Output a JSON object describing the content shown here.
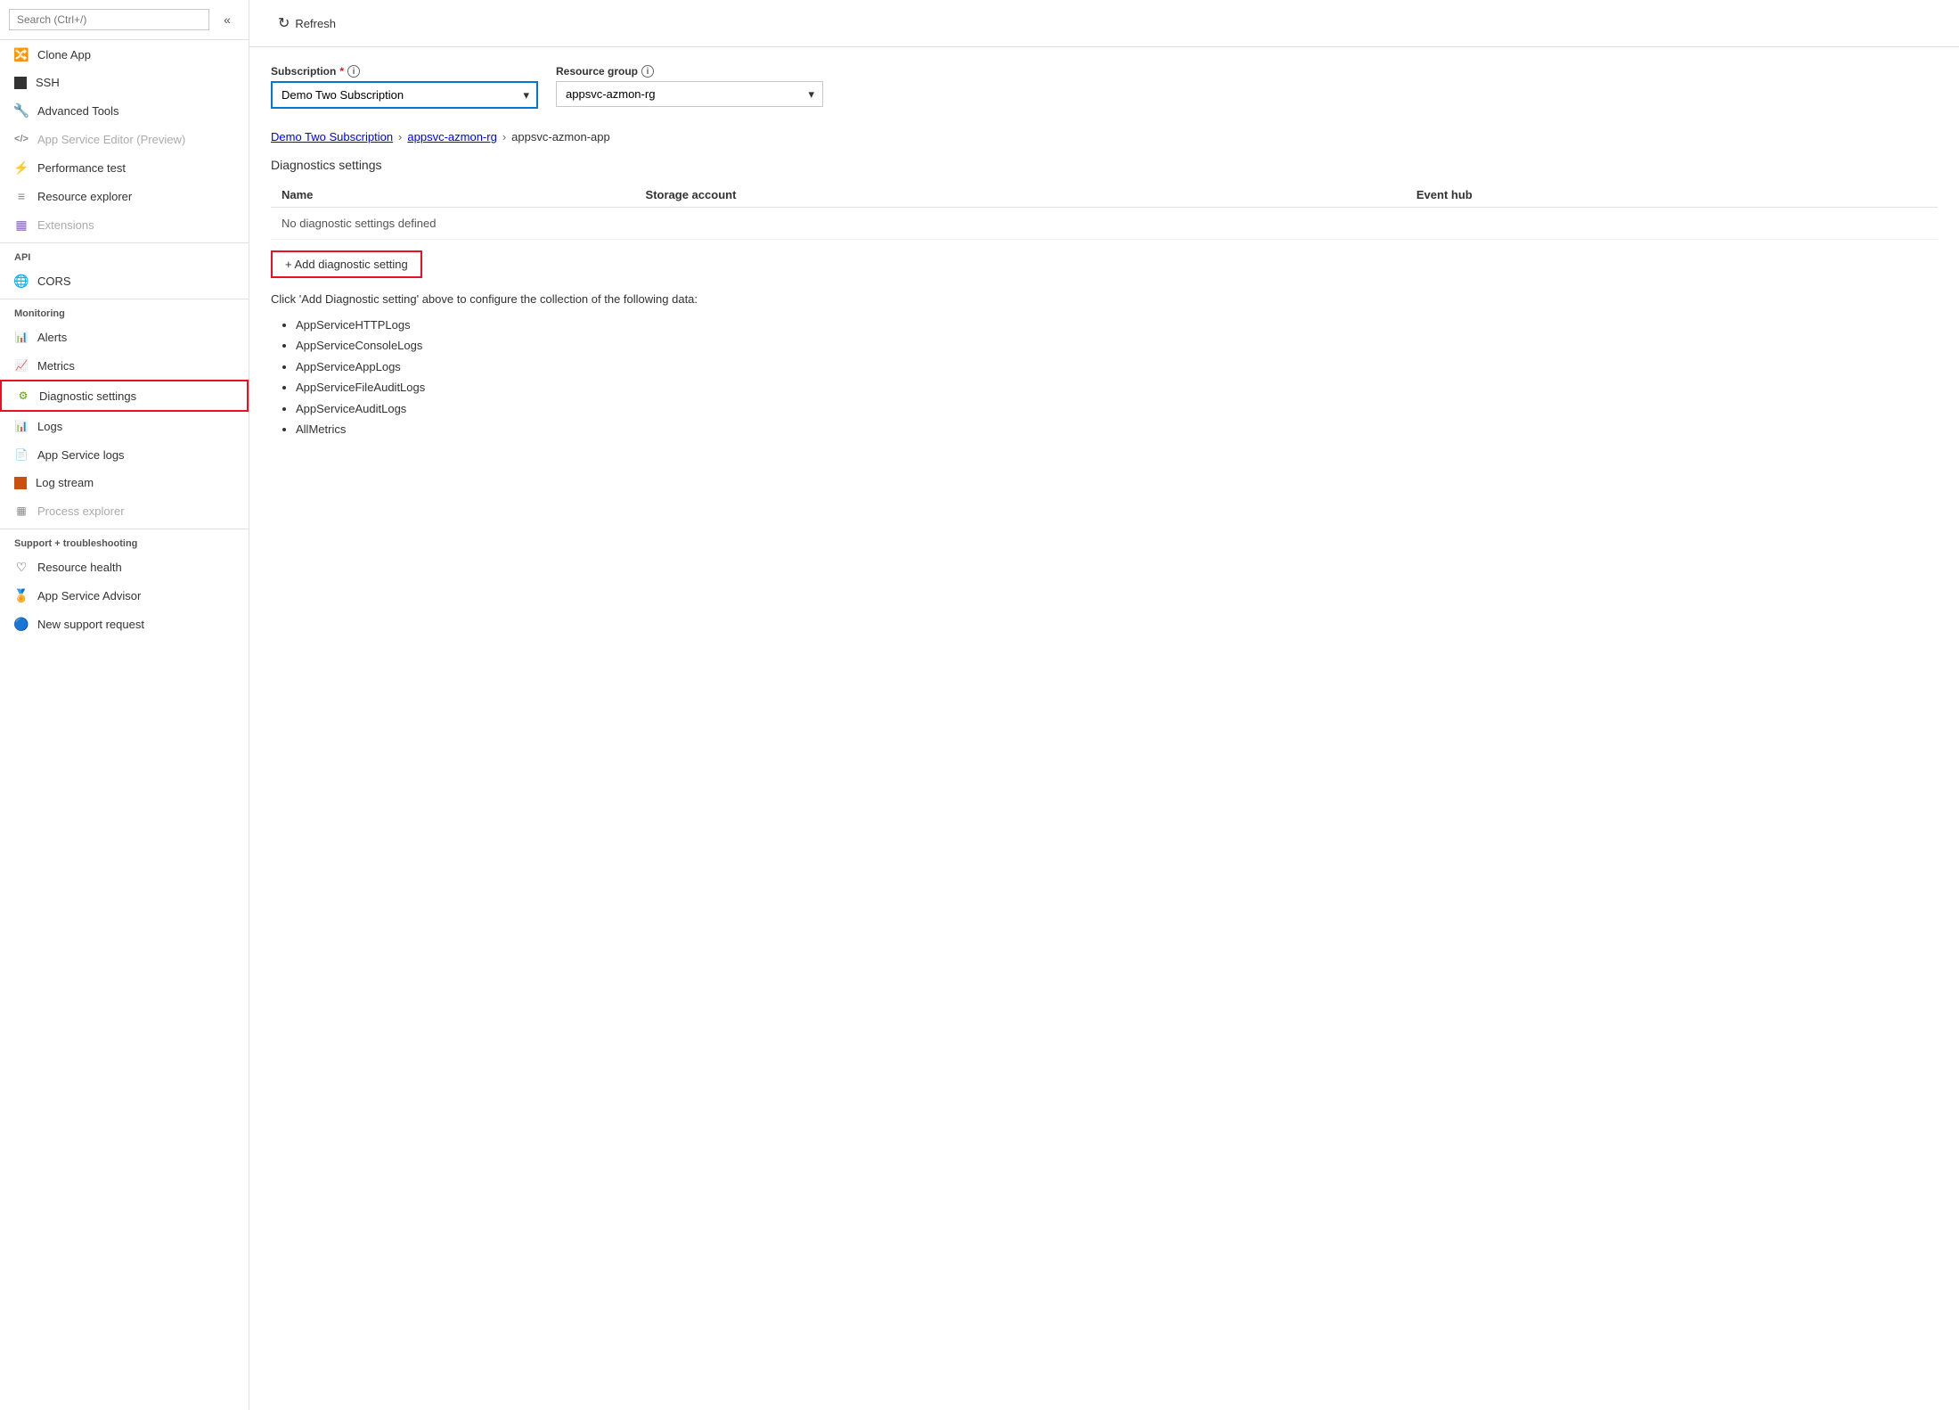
{
  "sidebar": {
    "search_placeholder": "Search (Ctrl+/)",
    "items": [
      {
        "id": "clone-app",
        "label": "Clone App",
        "icon": "🔀",
        "icon_color": "icon-green",
        "disabled": false
      },
      {
        "id": "ssh",
        "label": "SSH",
        "icon": "⬛",
        "icon_color": "icon-gray",
        "disabled": false
      },
      {
        "id": "advanced-tools",
        "label": "Advanced Tools",
        "icon": "🔧",
        "icon_color": "icon-blue",
        "disabled": false
      },
      {
        "id": "app-service-editor",
        "label": "App Service Editor (Preview)",
        "icon": "</>",
        "icon_color": "icon-gray",
        "disabled": true
      },
      {
        "id": "performance-test",
        "label": "Performance test",
        "icon": "⚡",
        "icon_color": "icon-blue",
        "disabled": false
      },
      {
        "id": "resource-explorer",
        "label": "Resource explorer",
        "icon": "📋",
        "icon_color": "icon-gray",
        "disabled": false
      },
      {
        "id": "extensions",
        "label": "Extensions",
        "icon": "🔲",
        "icon_color": "icon-purple",
        "disabled": true
      }
    ],
    "api_section": "API",
    "api_items": [
      {
        "id": "cors",
        "label": "CORS",
        "icon": "🌐",
        "icon_color": "icon-green",
        "disabled": false
      }
    ],
    "monitoring_section": "Monitoring",
    "monitoring_items": [
      {
        "id": "alerts",
        "label": "Alerts",
        "icon": "📊",
        "icon_color": "icon-green",
        "disabled": false
      },
      {
        "id": "metrics",
        "label": "Metrics",
        "icon": "📈",
        "icon_color": "icon-blue",
        "disabled": false
      },
      {
        "id": "diagnostic-settings",
        "label": "Diagnostic settings",
        "icon": "⚙",
        "icon_color": "icon-lime",
        "disabled": false,
        "active": true
      },
      {
        "id": "logs",
        "label": "Logs",
        "icon": "📊",
        "icon_color": "icon-blue",
        "disabled": false
      },
      {
        "id": "app-service-logs",
        "label": "App Service logs",
        "icon": "📄",
        "icon_color": "icon-orange",
        "disabled": false
      },
      {
        "id": "log-stream",
        "label": "Log stream",
        "icon": "🔶",
        "icon_color": "icon-orange",
        "disabled": false
      },
      {
        "id": "process-explorer",
        "label": "Process explorer",
        "icon": "🔲",
        "icon_color": "icon-gray",
        "disabled": true
      }
    ],
    "support_section": "Support + troubleshooting",
    "support_items": [
      {
        "id": "resource-health",
        "label": "Resource health",
        "icon": "♡",
        "icon_color": "icon-gray",
        "disabled": false
      },
      {
        "id": "app-service-advisor",
        "label": "App Service Advisor",
        "icon": "🏅",
        "icon_color": "icon-blue",
        "disabled": false
      },
      {
        "id": "new-support-request",
        "label": "New support request",
        "icon": "🔵",
        "icon_color": "icon-blue",
        "disabled": false
      }
    ]
  },
  "toolbar": {
    "refresh_label": "Refresh"
  },
  "content": {
    "subscription_label": "Subscription",
    "subscription_required": "*",
    "subscription_value": "Demo Two Subscription",
    "resource_group_label": "Resource group",
    "resource_group_value": "appsvc-azmon-rg",
    "breadcrumb": {
      "part1": "Demo Two Subscription",
      "part2": "appsvc-azmon-rg",
      "part3": "appsvc-azmon-app"
    },
    "diagnostics_title": "Diagnostics settings",
    "table_headers": [
      "Name",
      "Storage account",
      "Event hub"
    ],
    "no_settings_msg": "No diagnostic settings defined",
    "add_btn_label": "+ Add diagnostic setting",
    "info_text": "Click 'Add Diagnostic setting' above to configure the collection of the following data:",
    "data_types": [
      "AppServiceHTTPLogs",
      "AppServiceConsoleLogs",
      "AppServiceAppLogs",
      "AppServiceFileAuditLogs",
      "AppServiceAuditLogs",
      "AllMetrics"
    ]
  }
}
